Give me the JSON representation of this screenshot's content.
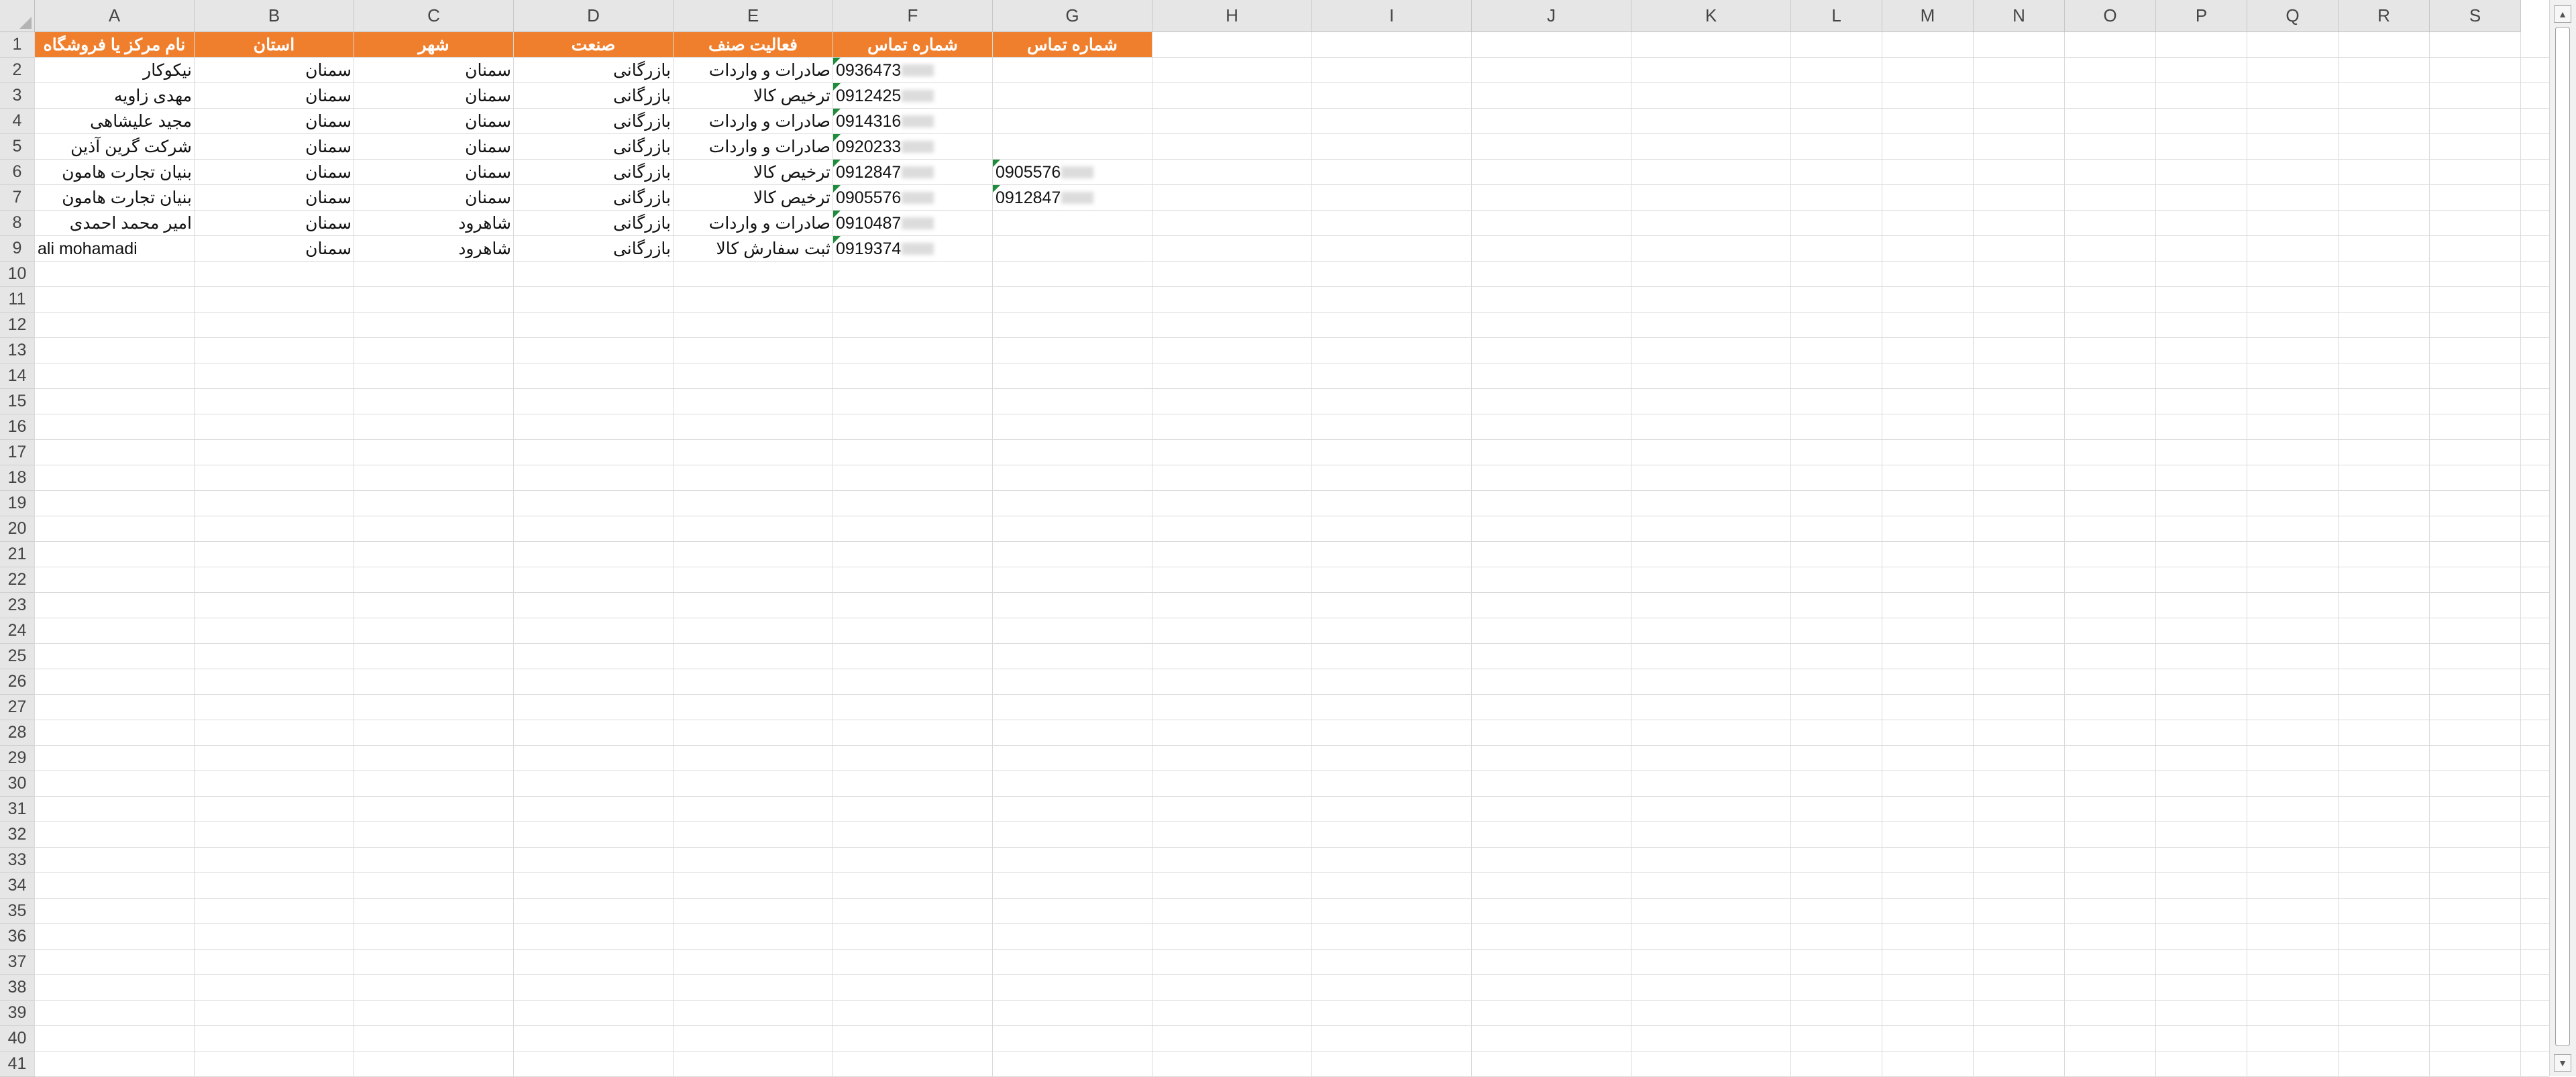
{
  "columns": [
    "A",
    "B",
    "C",
    "D",
    "E",
    "F",
    "G",
    "H",
    "I",
    "J",
    "K",
    "L",
    "M",
    "N",
    "O",
    "P",
    "Q",
    "R",
    "S"
  ],
  "row_numbers": [
    "1",
    "2",
    "3",
    "4",
    "5",
    "6",
    "7",
    "8",
    "9",
    "10",
    "11",
    "12",
    "13",
    "14",
    "15",
    "16",
    "17",
    "18",
    "19",
    "20",
    "21",
    "22",
    "23",
    "24",
    "25",
    "26",
    "27",
    "28",
    "29",
    "30",
    "31",
    "32",
    "33",
    "34",
    "35",
    "36",
    "37",
    "38",
    "39",
    "40",
    "41"
  ],
  "header_fill": "#f07f2d",
  "error_indicator_color": "#1e8c3a",
  "table": {
    "headers": [
      "نام مرکز یا فروشگاه",
      "استان",
      "شهر",
      "صنعت",
      "فعالیت صنف",
      "شماره تماس",
      "شماره تماس"
    ],
    "rows": [
      [
        "نیکوکار",
        "سمنان",
        "سمنان",
        "بازرگانی",
        "صادرات و واردات",
        "0936473",
        ""
      ],
      [
        "مهدی زاویه",
        "سمنان",
        "سمنان",
        "بازرگانی",
        "ترخیص کالا",
        "0912425",
        ""
      ],
      [
        "مجید علیشاهی",
        "سمنان",
        "سمنان",
        "بازرگانی",
        "صادرات و واردات",
        "0914316",
        ""
      ],
      [
        "شرکت گرین آذین",
        "سمنان",
        "سمنان",
        "بازرگانی",
        "صادرات و واردات",
        "0920233",
        ""
      ],
      [
        "بنیان تجارت هامون",
        "سمنان",
        "سمنان",
        "بازرگانی",
        "ترخیص کالا",
        "0912847",
        "0905576"
      ],
      [
        "بنیان تجارت هامون",
        "سمنان",
        "سمنان",
        "بازرگانی",
        "ترخیص کالا",
        "0905576",
        "0912847"
      ],
      [
        "امیر محمد احمدی",
        "سمنان",
        "شاهرود",
        "بازرگانی",
        "صادرات و واردات",
        "0910487",
        ""
      ],
      [
        "ali mohamadi",
        "سمنان",
        "شاهرود",
        "بازرگانی",
        "ثبت سفارش کالا",
        "0919374",
        ""
      ]
    ]
  },
  "scrollbar": {
    "up_icon": "chevron-up-icon",
    "down_icon": "chevron-down-icon"
  }
}
